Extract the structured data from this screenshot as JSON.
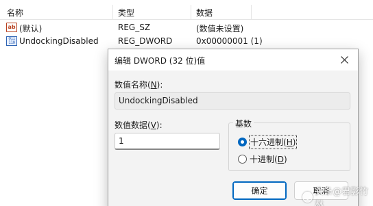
{
  "list": {
    "columns": {
      "name": "名称",
      "type": "类型",
      "data": "数据"
    },
    "rows": [
      {
        "icon": "string-value-icon",
        "name": "(默认)",
        "type": "REG_SZ",
        "data": "(数值未设置)"
      },
      {
        "icon": "binary-value-icon",
        "name": "UndockingDisabled",
        "type": "REG_DWORD",
        "data": "0x00000001 (1)"
      }
    ]
  },
  "dialog": {
    "title": "编辑 DWORD (32 位)值",
    "name_label": "数值名称(",
    "name_label_key": "N",
    "name_label_end": "):",
    "name_value": "UndockingDisabled",
    "value_label": "数值数据(",
    "value_label_key": "V",
    "value_label_end": "):",
    "value": "1",
    "base_label": "基数",
    "hex_label": "十六进制(",
    "hex_key": "H",
    "hex_end": ")",
    "hex_checked": true,
    "dec_label": "十进制(",
    "dec_key": "D",
    "dec_end": ")",
    "dec_checked": false,
    "ok_label": "确定",
    "cancel_label": "取消"
  },
  "watermark": {
    "text": "头条@君影竹林"
  },
  "colors": {
    "accent": "#0067c0",
    "dialog_bg": "#f3f3f3",
    "title_bg": "#ffffff"
  }
}
